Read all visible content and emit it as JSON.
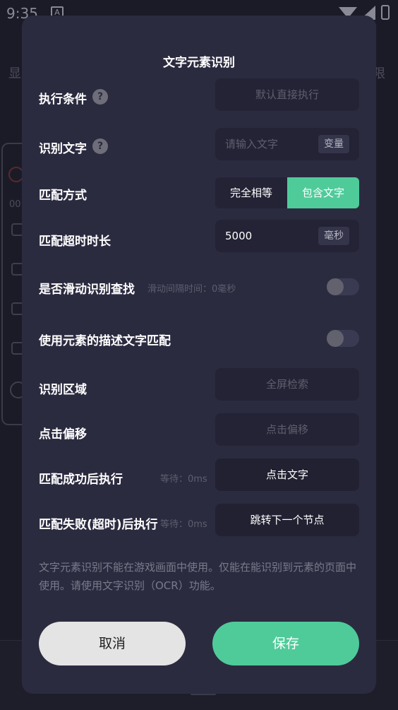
{
  "status_bar": {
    "time": "9:35",
    "indicator": "A"
  },
  "background": {
    "left_text": "显",
    "right_text": "限",
    "small_text": "00:"
  },
  "dialog": {
    "title": "文字元素识别",
    "rows": {
      "condition": {
        "label": "执行条件",
        "help": "?",
        "placeholder": "默认直接执行"
      },
      "text": {
        "label": "识别文字",
        "help": "?",
        "placeholder": "请输入文字",
        "suffix": "变量"
      },
      "match": {
        "label": "匹配方式",
        "option_exact": "完全相等",
        "option_contains": "包含文字",
        "selected": "包含文字"
      },
      "timeout": {
        "label": "匹配超时时长",
        "value": "5000",
        "suffix": "毫秒"
      },
      "scroll": {
        "label": "是否滑动识别查找",
        "hint": "滑动间隔时间：0毫秒",
        "enabled": false
      },
      "desc": {
        "label": "使用元素的描述文字匹配",
        "enabled": false
      },
      "region": {
        "label": "识别区域",
        "placeholder": "全屏检索"
      },
      "offset": {
        "label": "点击偏移",
        "placeholder": "点击偏移"
      },
      "success": {
        "label": "匹配成功后执行",
        "wait": "等待：0ms",
        "action": "点击文字"
      },
      "fail": {
        "label": "匹配失败(超时)后执行",
        "wait": "等待：0ms",
        "action": "跳转下一个节点"
      }
    },
    "note": "文字元素识别不能在游戏画面中使用。仅能在能识别到元素的页面中使用。请使用文字识别（OCR）功能。",
    "cancel_label": "取消",
    "save_label": "保存"
  },
  "colors": {
    "accent": "#4fcb9a",
    "dialog_bg": "#2b2b40",
    "field_bg": "#232335"
  }
}
